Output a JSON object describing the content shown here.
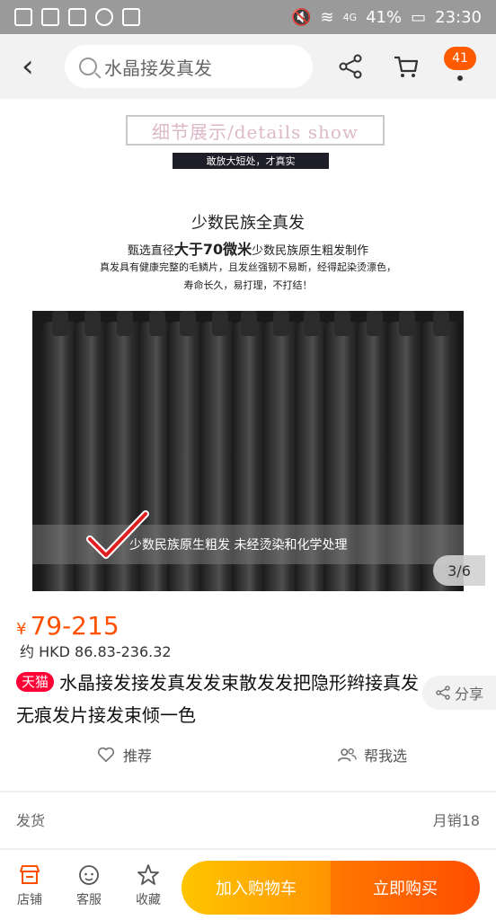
{
  "status_bar": {
    "battery": "41%",
    "time": "23:30",
    "network": "4G"
  },
  "nav": {
    "search_text": "水晶接发真发",
    "cart_badge": "41"
  },
  "hero": {
    "detail_title": "细节展示/details show",
    "detail_subtitle": "敢放大短处，才真实",
    "promo_title": "少数民族全真发",
    "promo_sub_a": "甄选直径",
    "promo_sub_b": "大于70微米",
    "promo_sub_c": "少数民族原生粗发制作",
    "promo_desc_1": "真发具有健康完整的毛鳞片，且发丝强韧不易断，经得起染烫漂色，",
    "promo_desc_2": "寿命长久，易打理，不打结！",
    "caption": "少数民族原生粗发 未经烫染和化学处理",
    "page_indicator": "3/6"
  },
  "product": {
    "currency": "¥",
    "price": "79-215",
    "hkd": "约 HKD 86.83-236.32",
    "tmall_tag": "天猫",
    "title": "水晶接发接发真发发束散发发把隐形辫接真发无痕发片接发束倾一色",
    "share_label": "分享"
  },
  "actions": {
    "recommend": "推荐",
    "help_choose": "帮我选"
  },
  "shipping": {
    "label": "发货",
    "monthly_sales": "月销18"
  },
  "bottom_bar": {
    "shop": "店铺",
    "service": "客服",
    "favorite": "收藏",
    "add_to_cart": "加入购物车",
    "buy_now": "立即购买"
  }
}
